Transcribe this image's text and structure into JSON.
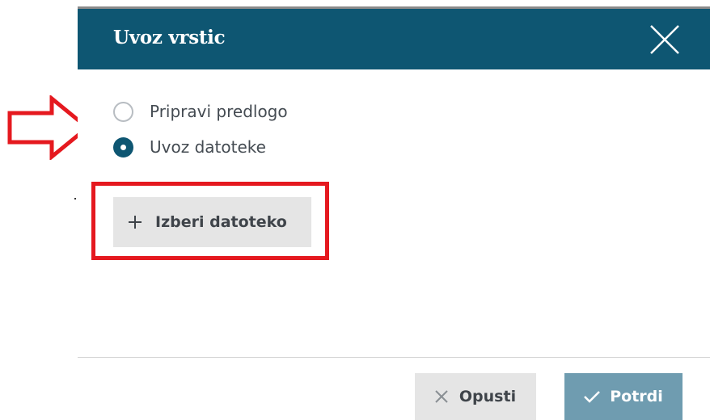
{
  "dialog": {
    "title": "Uvoz vrstic",
    "close_icon": "close-icon"
  },
  "import_mode": {
    "options": [
      {
        "label": "Pripravi predlogo",
        "selected": false
      },
      {
        "label": "Uvoz datoteke",
        "selected": true
      }
    ]
  },
  "file_picker": {
    "label": "Izberi datoteko",
    "icon": "plus-icon"
  },
  "footer": {
    "cancel_label": "Opusti",
    "cancel_icon": "close-icon",
    "confirm_label": "Potrdi",
    "confirm_icon": "check-icon"
  },
  "colors": {
    "header_bg": "#0e5672",
    "radio_selected": "#0e5672",
    "confirm_bg": "#6f9cb0",
    "secondary_btn_bg": "#e5e5e5",
    "annotation_red": "#e5191f"
  }
}
